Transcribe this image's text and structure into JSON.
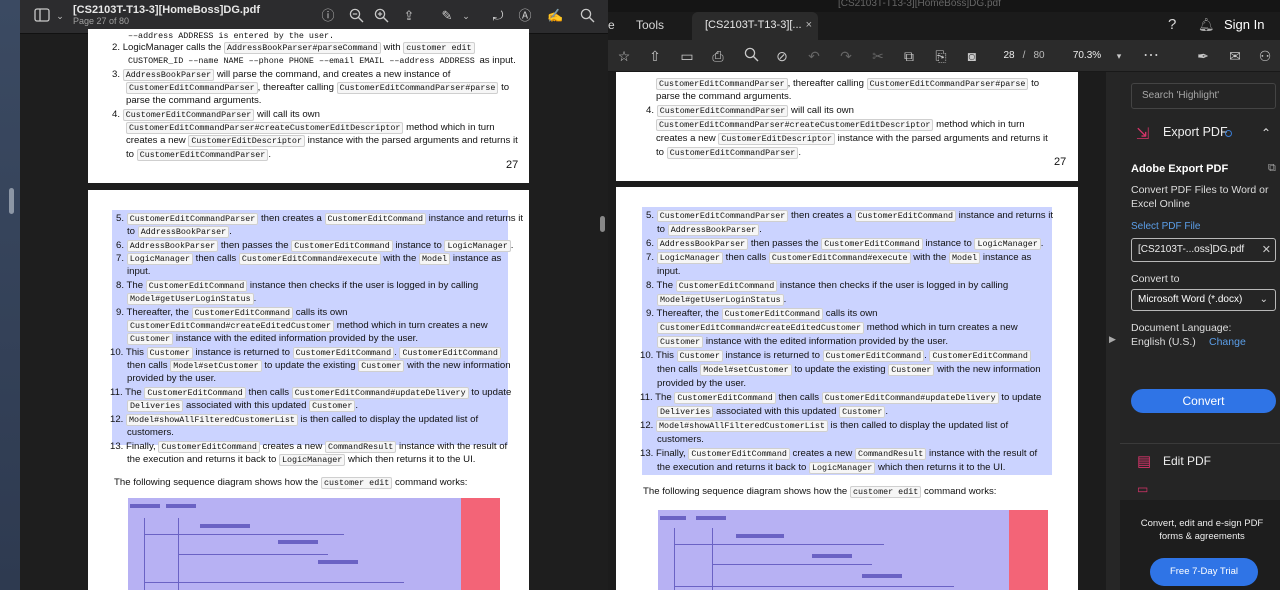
{
  "preview": {
    "title": "[CS2103T-T13-3][HomeBoss]DG.pdf",
    "subtitle": "Page 27 of 80"
  },
  "acrobat": {
    "window_title": "[CS2103T-T13-3][HomeBoss]DG.pdf",
    "menu_partial": "e",
    "menu_tools": "Tools",
    "doc_tab": "[CS2103T-T13-3][...",
    "doc_tab_close": "×",
    "sign_in": "Sign In",
    "page_current": "28",
    "page_sep": "/",
    "page_total": "80",
    "zoom": "70.3%"
  },
  "panel": {
    "search_placeholder": "Search 'Highlight'",
    "export_title": "Export PDF",
    "adobe_export": "Adobe Export PDF",
    "description": "Convert PDF Files to Word or Excel Online",
    "select_file": "Select PDF File",
    "file_name": "[CS2103T-...oss]DG.pdf",
    "convert_to": "Convert to",
    "format": "Microsoft Word (*.docx)",
    "doc_language": "Document Language:",
    "language": "English (U.S.)",
    "change": "Change",
    "convert_button": "Convert",
    "edit_pdf": "Edit PDF",
    "promo": "Convert, edit and e-sign PDF forms & agreements",
    "trial_button": "Free 7-Day Trial"
  },
  "doc": {
    "p27": {
      "l1": "––address ADDRESS  is entered by the user.",
      "l2a": "LogicManager calls the",
      "l2b": "AddressBookParser#parseCommand",
      "l2c": "with",
      "l2d": "customer edit",
      "l3": "CUSTOMER_ID ––name NAME ––phone PHONE ––email EMAIL ––address ADDRESS",
      "l3b": "as input.",
      "n3": "3.",
      "l4a": "AddressBookParser",
      "l4b": "will parse the command, and creates a new instance of",
      "l5a": "CustomerEditCommandParser",
      "l5b": ", thereafter calling",
      "l5c": "CustomerEditCommandParser#parse",
      "l5d": "to",
      "l6": "parse the command arguments.",
      "n4": "4.",
      "l7a": "CustomerEditCommandParser",
      "l7b": "will call its own",
      "l8a": "CustomerEditCommandParser#createCustomerEditDescriptor",
      "l8b": "method which in turn",
      "l9a": "creates a new",
      "l9b": "CustomerEditDescriptor",
      "l9c": "instance with the parsed arguments and returns it",
      "l10a": "to",
      "l10b": "CustomerEditCommandParser",
      "l10c": ".",
      "page_number": "27"
    },
    "p28": {
      "n5": "5.",
      "s5a": "CustomerEditCommandParser",
      "s5b": "then creates a",
      "s5c": "CustomerEditCommand",
      "s5d": "instance and returns it",
      "s5e": "to",
      "s5f": "AddressBookParser",
      "s5g": ".",
      "n6": "6.",
      "s6a": "AddressBookParser",
      "s6b": "then passes the",
      "s6c": "CustomerEditCommand",
      "s6d": "instance to",
      "s6e": "LogicManager",
      "s6f": ".",
      "n7": "7.",
      "s7a": "LogicManager",
      "s7b": "then calls",
      "s7c": "CustomerEditCommand#execute",
      "s7d": "with the",
      "s7e": "Model",
      "s7f": "instance as",
      "s7g": "input.",
      "n8": "8.",
      "s8a": "The",
      "s8b": "CustomerEditCommand",
      "s8c": "instance then checks if the user is logged in by calling",
      "s8d": "Model#getUserLoginStatus",
      "s8e": ".",
      "n9": "9.",
      "s9a": "Thereafter, the",
      "s9b": "CustomerEditCommand",
      "s9c": "calls its own",
      "s9d": "CustomerEditCommand#createEditedCustomer",
      "s9e": "method which in turn creates a new",
      "s9f": "Customer",
      "s9g": "instance with the edited information provided by the user.",
      "n10": "10.",
      "s10a": "This",
      "s10b": "Customer",
      "s10c": "instance is returned to",
      "s10d": "CustomerEditCommand",
      "s10e": ".",
      "s10f": "CustomerEditCommand",
      "s10g": "then calls",
      "s10h": "Model#setCustomer",
      "s10i": "to update the existing",
      "s10j": "Customer",
      "s10k": "with the new information",
      "s10l": "provided by the user.",
      "n11": "11.",
      "s11a": "The",
      "s11b": "CustomerEditCommand",
      "s11c": "then calls",
      "s11d": "CustomerEditCommand#updateDelivery",
      "s11e": "to update",
      "s11f": "Deliveries",
      "s11g": "associated with this updated",
      "s11h": "Customer",
      "s11i": ".",
      "n12": "12.",
      "s12a": "Model#showAllFilteredCustomerList",
      "s12b": "is then called to display the updated list of",
      "s12c": "customers.",
      "n13": "13.",
      "s13a": "Finally,",
      "s13b": "CustomerEditCommand",
      "s13c": "creates a new",
      "s13d": "CommandResult",
      "s13e": "instance with the result of",
      "s13f": "the execution and returns it back to",
      "s13g": "LogicManager",
      "s13h": "which then returns it to the UI.",
      "seq_a": "The following sequence diagram shows how the",
      "seq_b": "customer edit",
      "seq_c": "command works:"
    }
  }
}
